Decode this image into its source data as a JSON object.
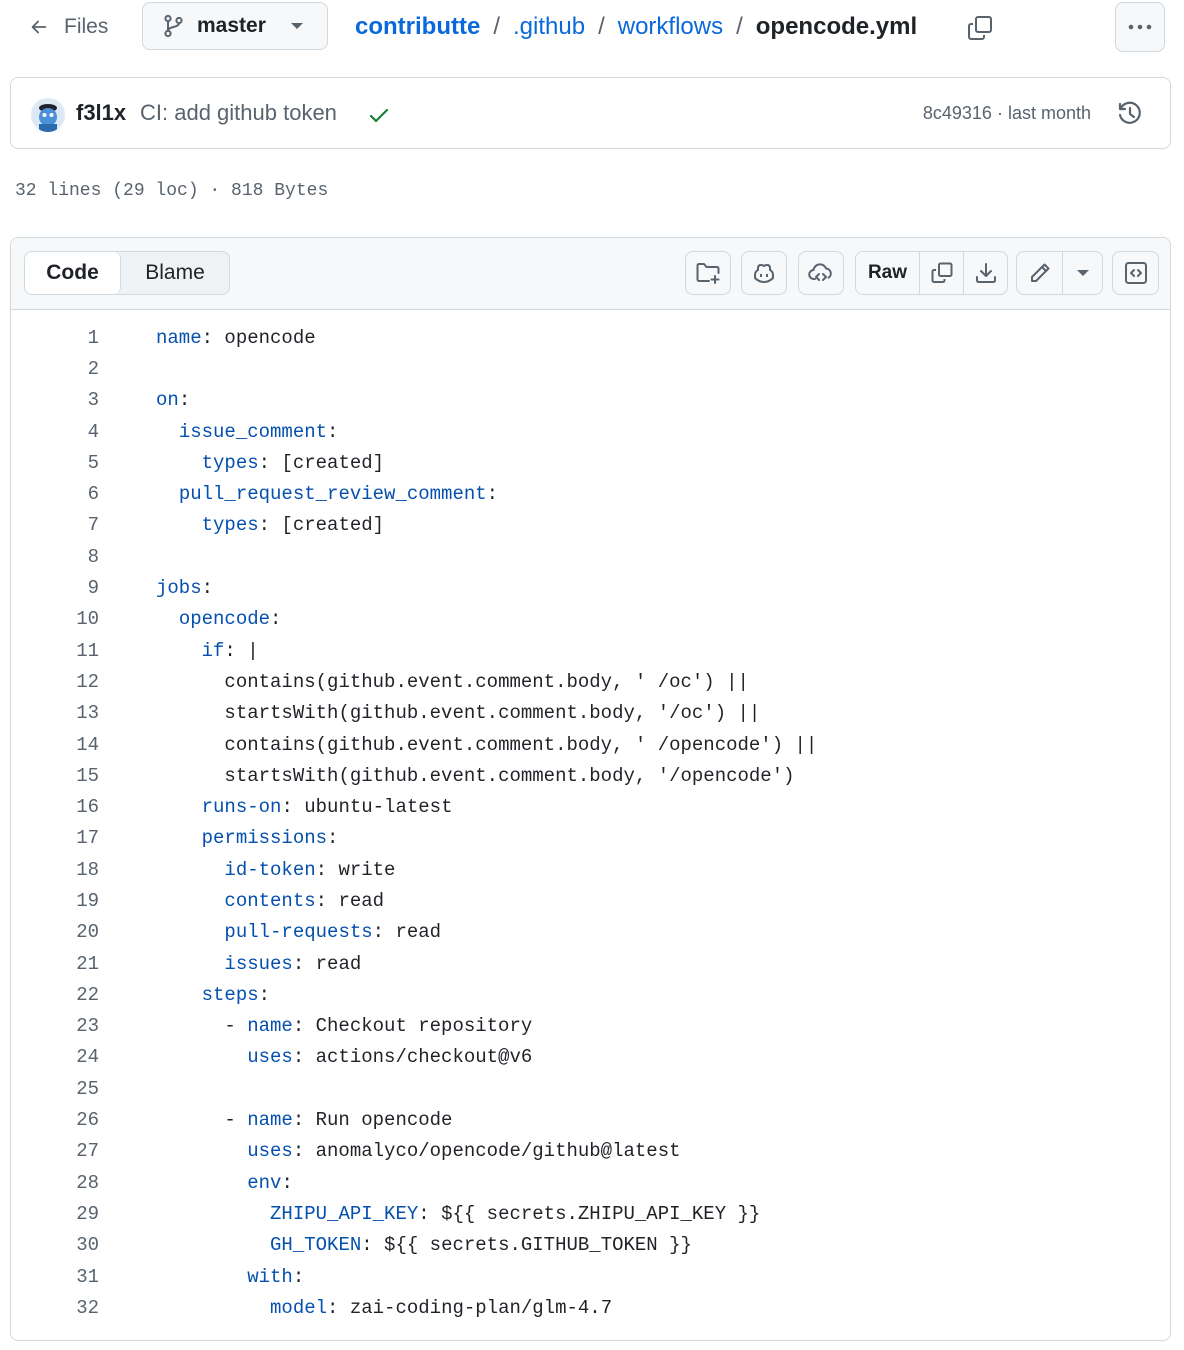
{
  "nav": {
    "files_label": "Files",
    "branch": "master",
    "breadcrumb": {
      "repo": "contributte",
      "dir1": ".github",
      "dir2": "workflows",
      "file": "opencode.yml",
      "separator": "/"
    }
  },
  "commit": {
    "author": "f3l1x",
    "message": "CI: add github token",
    "sha": "8c49316",
    "meta_separator": "·",
    "time": "last month",
    "status_color": "#1a7f37"
  },
  "file_info": "32 lines (29 loc) · 818 Bytes",
  "toolbar": {
    "tab_code": "Code",
    "tab_blame": "Blame",
    "raw_label": "Raw",
    "icons": [
      "folder-plus-icon",
      "copilot-icon",
      "cloud-code-icon",
      "copy-icon",
      "download-icon",
      "pencil-icon",
      "chevron-down-icon",
      "code-square-icon"
    ]
  },
  "code": {
    "key_color": "#0550ae",
    "lines": [
      {
        "n": "1",
        "indent": "",
        "key": "name",
        "rest": ": opencode"
      },
      {
        "n": "2",
        "indent": "",
        "key": "",
        "rest": ""
      },
      {
        "n": "3",
        "indent": "",
        "key": "on",
        "rest": ":"
      },
      {
        "n": "4",
        "indent": "  ",
        "key": "issue_comment",
        "rest": ":"
      },
      {
        "n": "5",
        "indent": "    ",
        "key": "types",
        "rest": ": [created]"
      },
      {
        "n": "6",
        "indent": "  ",
        "key": "pull_request_review_comment",
        "rest": ":"
      },
      {
        "n": "7",
        "indent": "    ",
        "key": "types",
        "rest": ": [created]"
      },
      {
        "n": "8",
        "indent": "",
        "key": "",
        "rest": ""
      },
      {
        "n": "9",
        "indent": "",
        "key": "jobs",
        "rest": ":"
      },
      {
        "n": "10",
        "indent": "  ",
        "key": "opencode",
        "rest": ":"
      },
      {
        "n": "11",
        "indent": "    ",
        "key": "if",
        "rest": ": |"
      },
      {
        "n": "12",
        "indent": "      ",
        "key": "",
        "rest": "contains(github.event.comment.body, ' /oc') ||"
      },
      {
        "n": "13",
        "indent": "      ",
        "key": "",
        "rest": "startsWith(github.event.comment.body, '/oc') ||"
      },
      {
        "n": "14",
        "indent": "      ",
        "key": "",
        "rest": "contains(github.event.comment.body, ' /opencode') ||"
      },
      {
        "n": "15",
        "indent": "      ",
        "key": "",
        "rest": "startsWith(github.event.comment.body, '/opencode')"
      },
      {
        "n": "16",
        "indent": "    ",
        "key": "runs-on",
        "rest": ": ubuntu-latest"
      },
      {
        "n": "17",
        "indent": "    ",
        "key": "permissions",
        "rest": ":"
      },
      {
        "n": "18",
        "indent": "      ",
        "key": "id-token",
        "rest": ": write"
      },
      {
        "n": "19",
        "indent": "      ",
        "key": "contents",
        "rest": ": read"
      },
      {
        "n": "20",
        "indent": "      ",
        "key": "pull-requests",
        "rest": ": read"
      },
      {
        "n": "21",
        "indent": "      ",
        "key": "issues",
        "rest": ": read"
      },
      {
        "n": "22",
        "indent": "    ",
        "key": "steps",
        "rest": ":"
      },
      {
        "n": "23",
        "indent": "      - ",
        "key": "name",
        "rest": ": Checkout repository"
      },
      {
        "n": "24",
        "indent": "        ",
        "key": "uses",
        "rest": ": actions/checkout@v6"
      },
      {
        "n": "25",
        "indent": "",
        "key": "",
        "rest": ""
      },
      {
        "n": "26",
        "indent": "      - ",
        "key": "name",
        "rest": ": Run opencode"
      },
      {
        "n": "27",
        "indent": "        ",
        "key": "uses",
        "rest": ": anomalyco/opencode/github@latest"
      },
      {
        "n": "28",
        "indent": "        ",
        "key": "env",
        "rest": ":"
      },
      {
        "n": "29",
        "indent": "          ",
        "key": "ZHIPU_API_KEY",
        "rest": ": ${{ secrets.ZHIPU_API_KEY }}"
      },
      {
        "n": "30",
        "indent": "          ",
        "key": "GH_TOKEN",
        "rest": ": ${{ secrets.GITHUB_TOKEN }}"
      },
      {
        "n": "31",
        "indent": "        ",
        "key": "with",
        "rest": ":"
      },
      {
        "n": "32",
        "indent": "          ",
        "key": "model",
        "rest": ": zai-coding-plan/glm-4.7"
      }
    ]
  }
}
